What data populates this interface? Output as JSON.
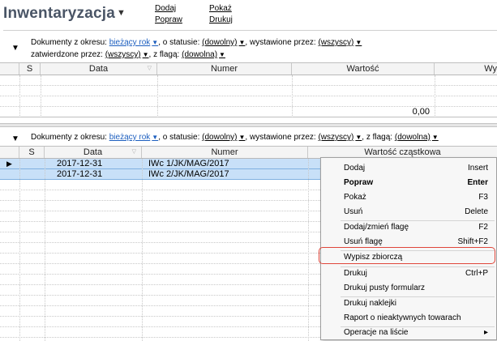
{
  "app": {
    "title": "Inwentaryzacja",
    "links": [
      "Dodaj",
      "Pokaż",
      "Popraw",
      "Drukuj"
    ]
  },
  "panel1": {
    "filter": {
      "l_okres": "Dokumenty z okresu:",
      "okres": "bieżący rok",
      "l_status": ", o statusie:",
      "status": "(dowolny)",
      "l_wyst": ", wystawione przez:",
      "wyst": "(wszyscy)",
      "l_zatw": "zatwierdzone przez:",
      "zatw": "(wszyscy)",
      "l_flaga": ", z flagą:",
      "flaga": "(dowolna)"
    },
    "columns": [
      "S",
      "Data",
      "Numer",
      "Wartość",
      "Wy"
    ],
    "total": "0,00"
  },
  "panel2": {
    "filter": {
      "l_okres": "Dokumenty z okresu:",
      "okres": "bieżący rok",
      "l_status": ", o statusie:",
      "status": "(dowolny)",
      "l_wyst": ", wystawione przez:",
      "wyst": "(wszyscy)",
      "l_flaga": ", z flagą:",
      "flaga": "(dowolna)"
    },
    "columns": [
      "S",
      "Data",
      "Numer",
      "Wartość cząstkowa"
    ],
    "rows": [
      {
        "data": "2017-12-31",
        "numer": "IWc 1/JK/MAG/2017"
      },
      {
        "data": "2017-12-31",
        "numer": "IWc 2/JK/MAG/2017"
      }
    ]
  },
  "menu": {
    "items": [
      {
        "label": "Dodaj",
        "shortcut": "Insert"
      },
      {
        "label": "Popraw",
        "shortcut": "Enter"
      },
      {
        "label": "Pokaż",
        "shortcut": "F3"
      },
      {
        "label": "Usuń",
        "shortcut": "Delete"
      },
      {
        "label": "Dodaj/zmień flagę",
        "shortcut": "F2"
      },
      {
        "label": "Usuń flagę",
        "shortcut": "Shift+F2"
      },
      {
        "label": "Wypisz zbiorczą",
        "shortcut": ""
      },
      {
        "label": "Drukuj",
        "shortcut": "Ctrl+P"
      },
      {
        "label": "Drukuj pusty formularz",
        "shortcut": ""
      },
      {
        "label": "Drukuj naklejki",
        "shortcut": ""
      },
      {
        "label": "Raport o nieaktywnych towarach",
        "shortcut": ""
      },
      {
        "label": "Operacje na liście",
        "shortcut": "▸"
      }
    ]
  }
}
